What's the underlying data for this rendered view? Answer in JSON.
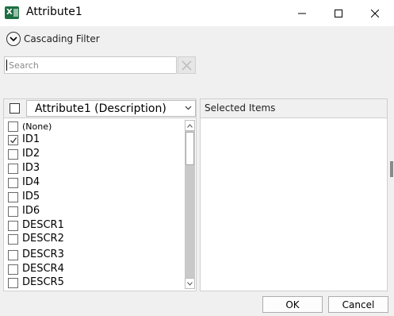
{
  "window": {
    "title": "Attribute1",
    "app_icon": "excel-icon",
    "app_icon_letter": "X"
  },
  "cascade": {
    "label": "Cascading Filter",
    "icon": "chevron-down-circle-icon"
  },
  "search": {
    "placeholder": "Search",
    "value": "",
    "clear_icon": "close-icon"
  },
  "list": {
    "column_selector": "Attribute1 (Description)",
    "items": [
      {
        "label": "(None)",
        "checked": false
      },
      {
        "label": "ID1",
        "checked": true
      },
      {
        "label": "ID2",
        "checked": false
      },
      {
        "label": "ID3",
        "checked": false
      },
      {
        "label": "ID4",
        "checked": false
      },
      {
        "label": "ID5",
        "checked": false
      },
      {
        "label": "ID6",
        "checked": false
      },
      {
        "label": "DESCR1",
        "checked": false
      },
      {
        "label": "DESCR2",
        "checked": false
      },
      {
        "label": "DESCR3",
        "checked": false
      },
      {
        "label": "DESCR4",
        "checked": false
      },
      {
        "label": "DESCR5",
        "checked": false
      }
    ]
  },
  "selected": {
    "header": "Selected Items",
    "items": []
  },
  "buttons": {
    "ok": "OK",
    "cancel": "Cancel"
  },
  "colors": {
    "excel_green": "#1d6f42",
    "dialog_bg": "#f0f0f0"
  }
}
